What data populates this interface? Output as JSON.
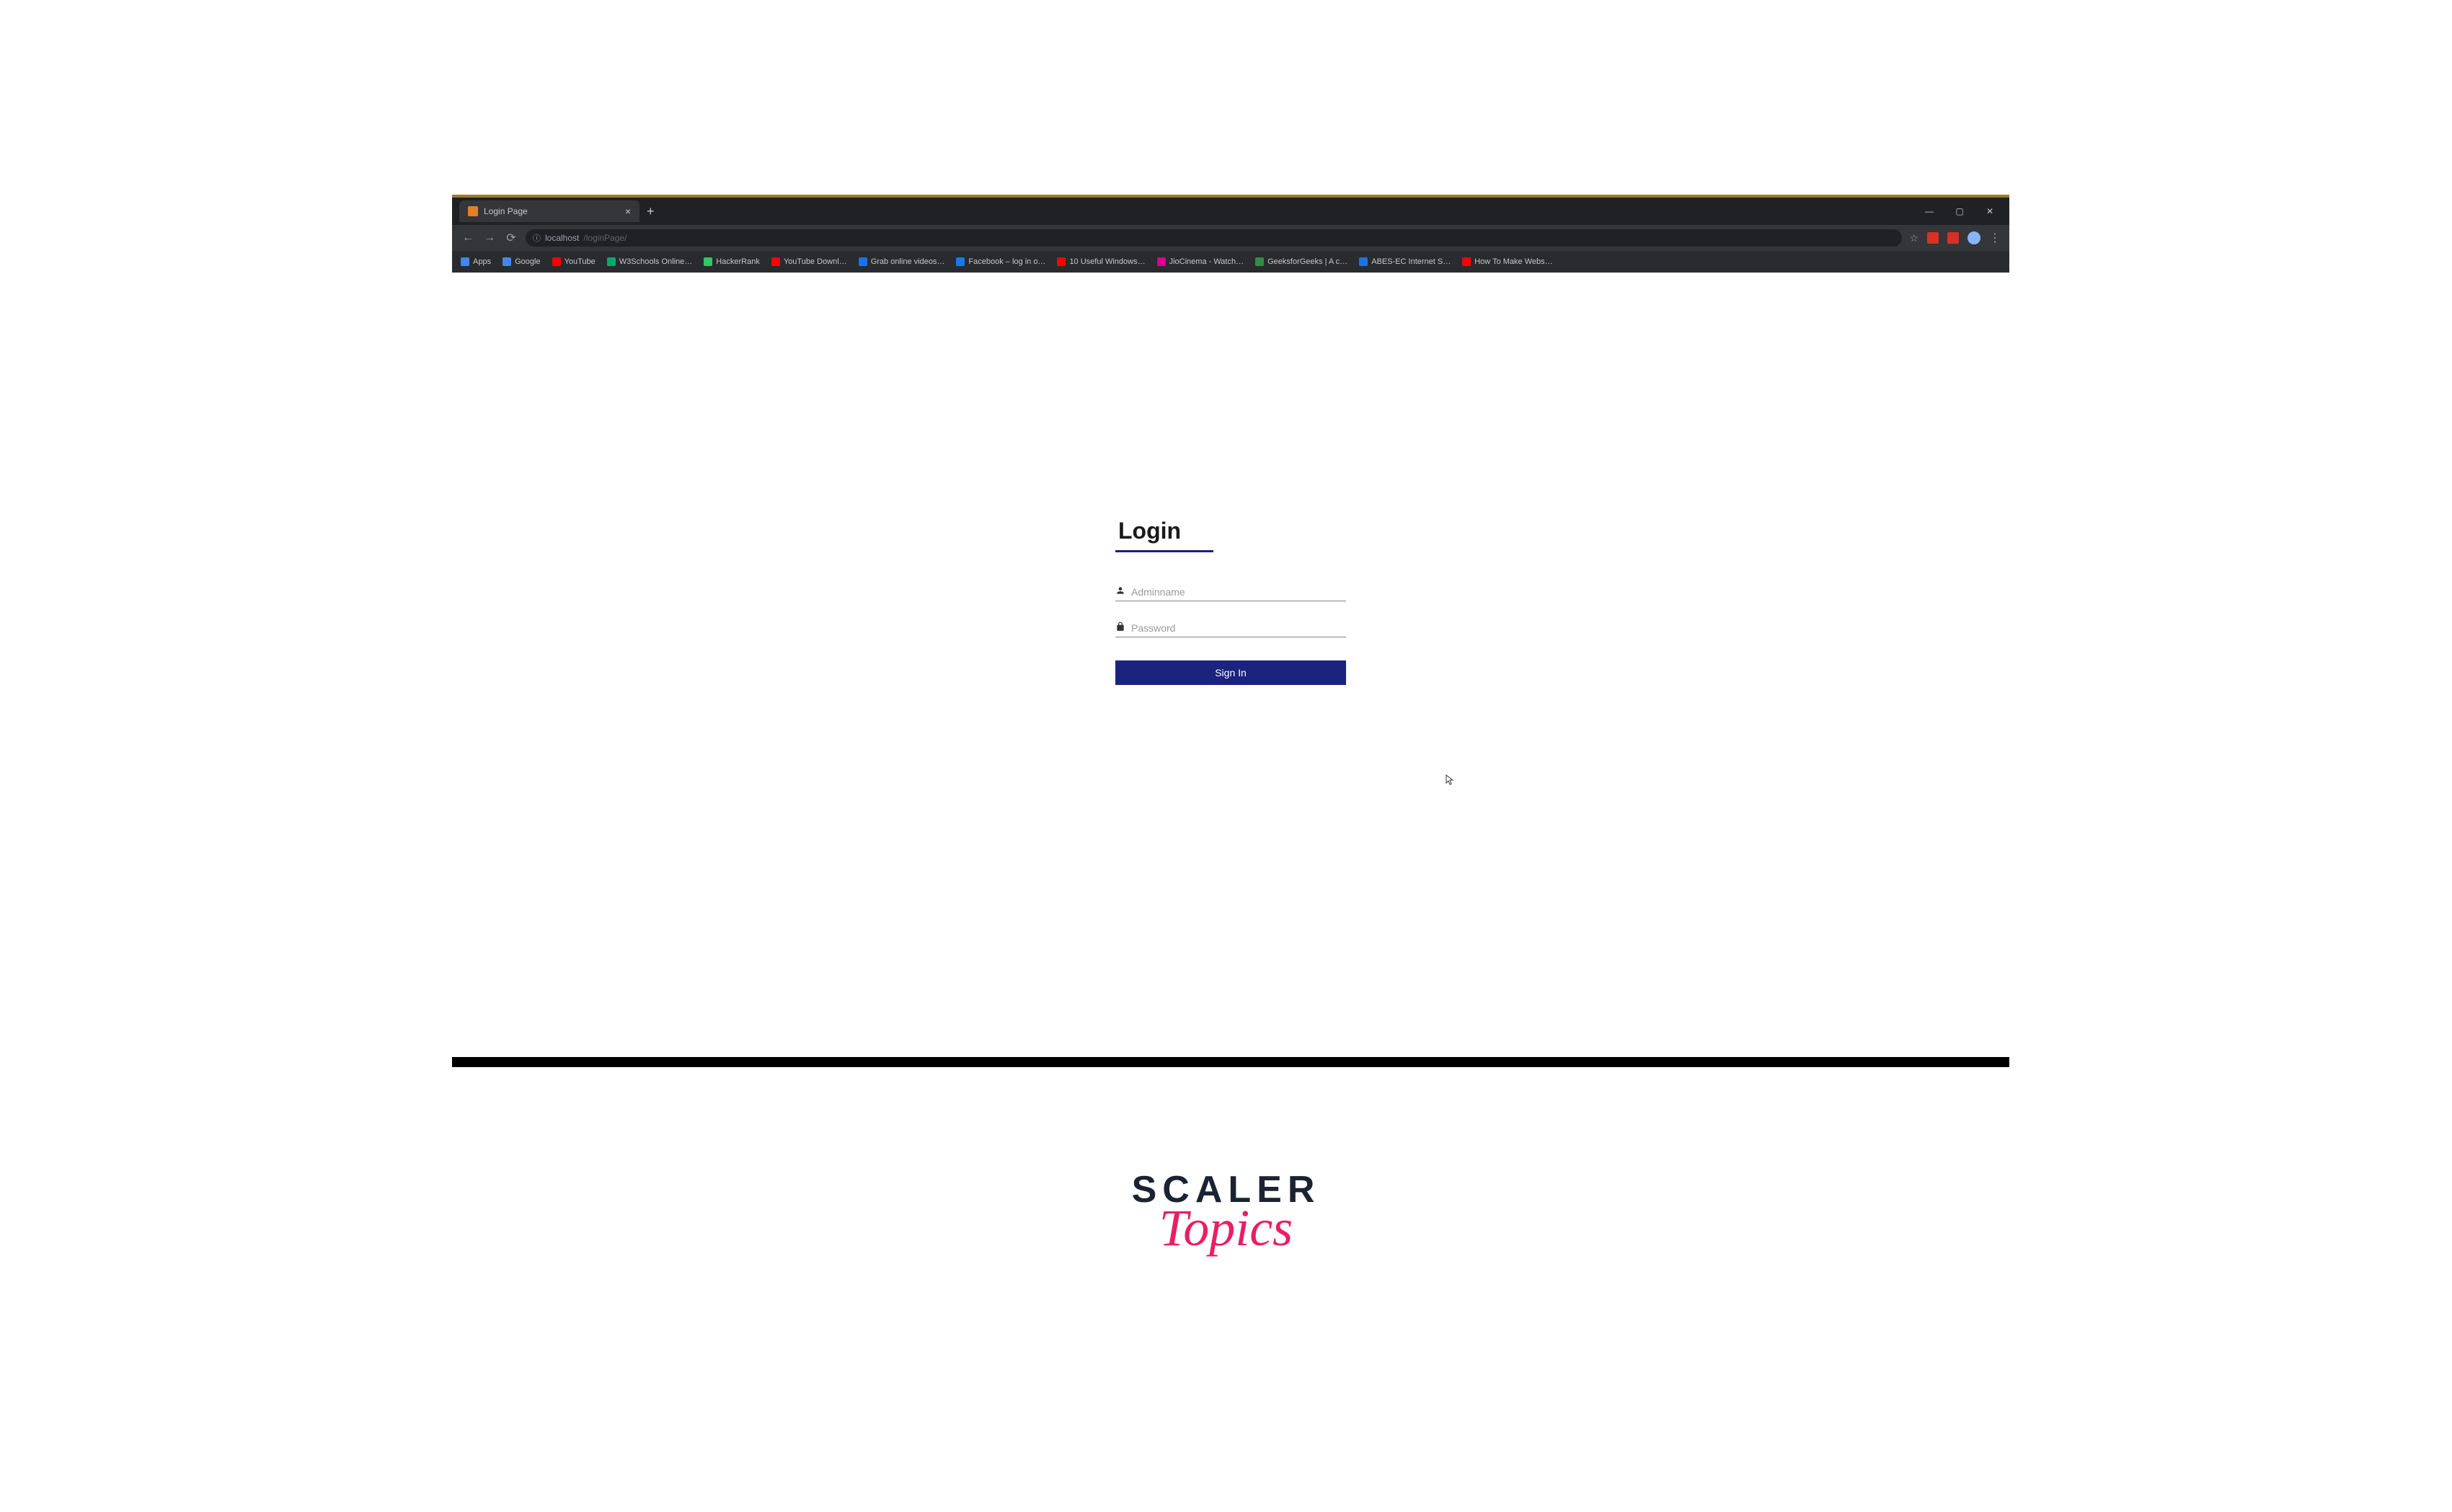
{
  "tab": {
    "title": "Login Page"
  },
  "url": {
    "host": "localhost",
    "path": "/loginPage/"
  },
  "bookmarks": [
    {
      "label": "Apps",
      "color": "#4285f4"
    },
    {
      "label": "Google",
      "color": "#4285f4"
    },
    {
      "label": "YouTube",
      "color": "#ff0000"
    },
    {
      "label": "W3Schools Online…",
      "color": "#04aa6d"
    },
    {
      "label": "HackerRank",
      "color": "#2ec866"
    },
    {
      "label": "YouTube Downl…",
      "color": "#ff0000"
    },
    {
      "label": "Grab online videos…",
      "color": "#1a73e8"
    },
    {
      "label": "Facebook – log in o…",
      "color": "#1877f2"
    },
    {
      "label": "10 Useful Windows…",
      "color": "#ff0000"
    },
    {
      "label": "JioCinema - Watch…",
      "color": "#d9008d"
    },
    {
      "label": "GeeksforGeeks | A c…",
      "color": "#2f8d46"
    },
    {
      "label": "ABES-EC Internet S…",
      "color": "#1a73e8"
    },
    {
      "label": "How To Make Webs…",
      "color": "#ff0000"
    }
  ],
  "login": {
    "title": "Login",
    "username_placeholder": "Adminname",
    "password_placeholder": "Password",
    "button_label": "Sign In"
  },
  "watermark": {
    "line1": "SCALER",
    "line2": "Topics"
  }
}
